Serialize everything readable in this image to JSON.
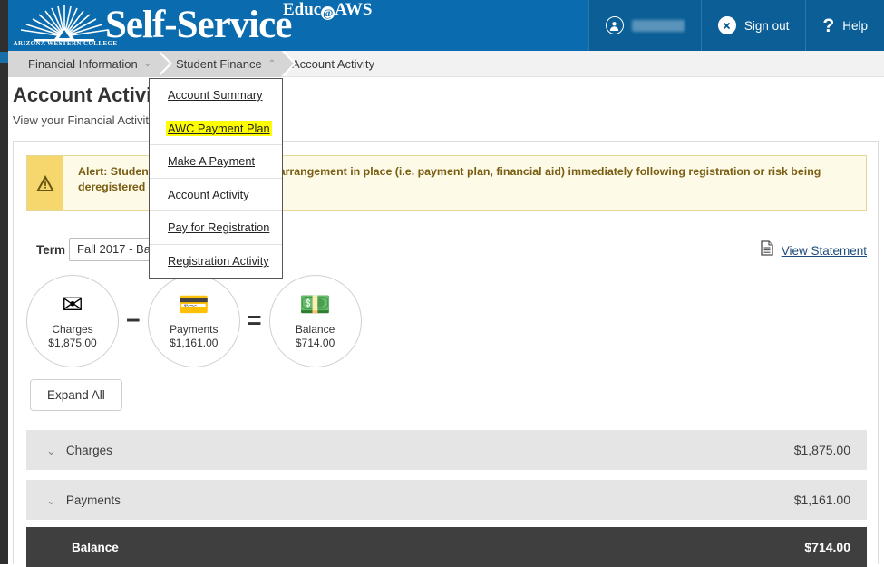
{
  "header": {
    "logo_text": "Self-Service",
    "logo_superscript_pre": "Educ",
    "logo_superscript_post": "AWS",
    "logo_at_symbol": "@",
    "college_name": "ARIZONA WESTERN COLLEGE",
    "brand_color": "#0a6cae",
    "brand_color_dark": "#0b5e96",
    "user_name": "",
    "sign_out_label": "Sign out",
    "help_label": "Help",
    "help_icon_glyph": "?"
  },
  "breadcrumb": {
    "items": [
      {
        "label": "Financial Information",
        "caret": "⌄",
        "shaded": true
      },
      {
        "label": "Student Finance",
        "caret": "⌃",
        "shaded": true
      },
      {
        "label": "Account Activity",
        "caret": "",
        "shaded": false
      }
    ]
  },
  "page": {
    "title": "Account Activity",
    "subtitle": "View your Financial Activity"
  },
  "alert": {
    "icon": "warning-triangle-icon",
    "text": "Alert: Students must have a payment arrangement in place (i.e. payment plan, financial aid) immediately following registration or risk being deregistered from classes.",
    "bg_color": "#fdfbe8",
    "icon_bg_color": "#f5d76e",
    "text_color": "#7a5d12"
  },
  "term": {
    "label": "Term",
    "selected_value": "Fall 2017 - Balance",
    "view_statement_label": "View Statement",
    "view_statement_icon": "document-icon"
  },
  "summary": {
    "circles": [
      {
        "icon": "invoice-envelope-icon",
        "emoji": "✉",
        "label": "Charges",
        "value": "$1,875.00"
      },
      {
        "icon": "check-pen-icon",
        "emoji": "💳",
        "label": "Payments",
        "value": "$1,161.00"
      },
      {
        "icon": "money-icon",
        "emoji": "💵",
        "label": "Balance",
        "value": "$714.00"
      }
    ],
    "operator_minus": "−",
    "operator_equals": "=",
    "expand_all_label": "Expand All"
  },
  "accordion": {
    "caret_glyph": "⌄",
    "rows": [
      {
        "label": "Charges",
        "value": "$1,875.00",
        "style": "light",
        "collapsible": true
      },
      {
        "label": "Payments",
        "value": "$1,161.00",
        "style": "light",
        "collapsible": true
      },
      {
        "label": "Balance",
        "value": "$714.00",
        "style": "dark",
        "collapsible": false
      }
    ]
  },
  "dropdown": {
    "items": [
      {
        "label": "Account Summary",
        "highlighted": false
      },
      {
        "label": "AWC Payment Plan",
        "highlighted": true
      },
      {
        "label": "Make A Payment",
        "highlighted": false
      },
      {
        "label": "Account Activity",
        "highlighted": false
      },
      {
        "label": "Pay for Registration",
        "highlighted": false
      },
      {
        "label": "Registration Activity",
        "highlighted": false
      }
    ],
    "highlight_color": "#ffff00"
  }
}
